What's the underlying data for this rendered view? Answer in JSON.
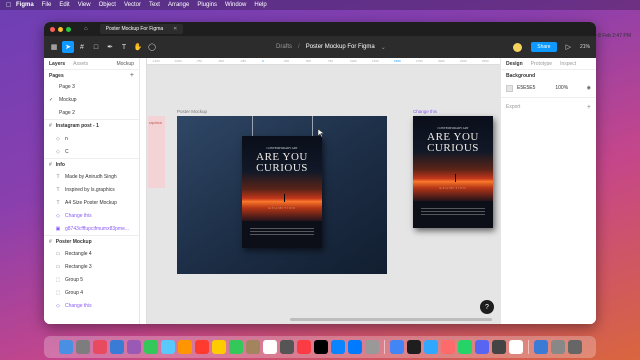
{
  "menubar": {
    "app": "Figma",
    "items": [
      "File",
      "Edit",
      "View",
      "Object",
      "Vector",
      "Text",
      "Arrange",
      "Plugins",
      "Window",
      "Help"
    ],
    "datetime": "Tue 8 Feb 2:47 PM"
  },
  "window": {
    "tab_title": "Poster Mockup For Figma"
  },
  "toolbar": {
    "breadcrumb_folder": "Drafts",
    "breadcrumb_file": "Poster Mockup For Figma",
    "share_label": "Share",
    "zoom": "21%"
  },
  "left_panel": {
    "tabs": [
      "Layers",
      "Assets"
    ],
    "page_selector": "Mockup",
    "pages_title": "Pages",
    "pages": [
      {
        "label": "Page 3",
        "active": false
      },
      {
        "label": "Mockup",
        "active": true
      },
      {
        "label": "Page 2",
        "active": false
      }
    ],
    "layers": [
      {
        "type": "section",
        "label": "Instagram post - 1",
        "icon": "frame-icon"
      },
      {
        "type": "layer",
        "label": "n",
        "icon": "component-icon"
      },
      {
        "type": "layer",
        "label": "C",
        "icon": "component-icon"
      },
      {
        "type": "section",
        "label": "Info",
        "icon": "frame-icon"
      },
      {
        "type": "layer",
        "label": "Made by Anirudh Singh",
        "icon": "text-icon"
      },
      {
        "type": "layer",
        "label": "Inspired by ls.graphics",
        "icon": "text-icon"
      },
      {
        "type": "layer",
        "label": "A4 Size Poster Mockup",
        "icon": "text-icon"
      },
      {
        "type": "layer-purple",
        "label": "Change this",
        "icon": "component-icon"
      },
      {
        "type": "layer-purple",
        "label": "g8743cfffupcifm­umx83pme...",
        "icon": "image-icon"
      },
      {
        "type": "section",
        "label": "Poster Mockup",
        "icon": "frame-icon"
      },
      {
        "type": "layer",
        "label": "Rectangle 4",
        "icon": "rectangle-icon"
      },
      {
        "type": "layer",
        "label": "Rectangle 3",
        "icon": "rectangle-icon"
      },
      {
        "type": "layer",
        "label": "Group 5",
        "icon": "group-icon"
      },
      {
        "type": "layer",
        "label": "Group 4",
        "icon": "group-icon"
      },
      {
        "type": "layer-purple",
        "label": "Change this",
        "icon": "component-icon"
      }
    ]
  },
  "canvas": {
    "ruler_ticks": [
      "-1250",
      "-1000",
      "-750",
      "-500",
      "-250",
      "0",
      "250",
      "500",
      "750",
      "1000",
      "1250",
      "1500",
      "1750",
      "2000",
      "2250",
      "2500"
    ],
    "frame_poster_mockup_label": "Poster Mockup",
    "frame_change_this_label": "Change this",
    "partial_frame_text": "raphics",
    "poster": {
      "tagline": "CONTEMPORARY ART",
      "title_line1": "ARE YOU",
      "title_line2": "CURIOUS",
      "subtitle": "EXHIBITION"
    }
  },
  "right_panel": {
    "tabs": [
      "Design",
      "Prototype",
      "Inspect"
    ],
    "background_label": "Background",
    "bg_hex": "E5E5E5",
    "bg_opacity": "100%",
    "export_label": "Export"
  },
  "colors": {
    "accent": "#0d99ff",
    "component": "#8b5cf6",
    "canvas_bg": "#e5e5e5"
  }
}
